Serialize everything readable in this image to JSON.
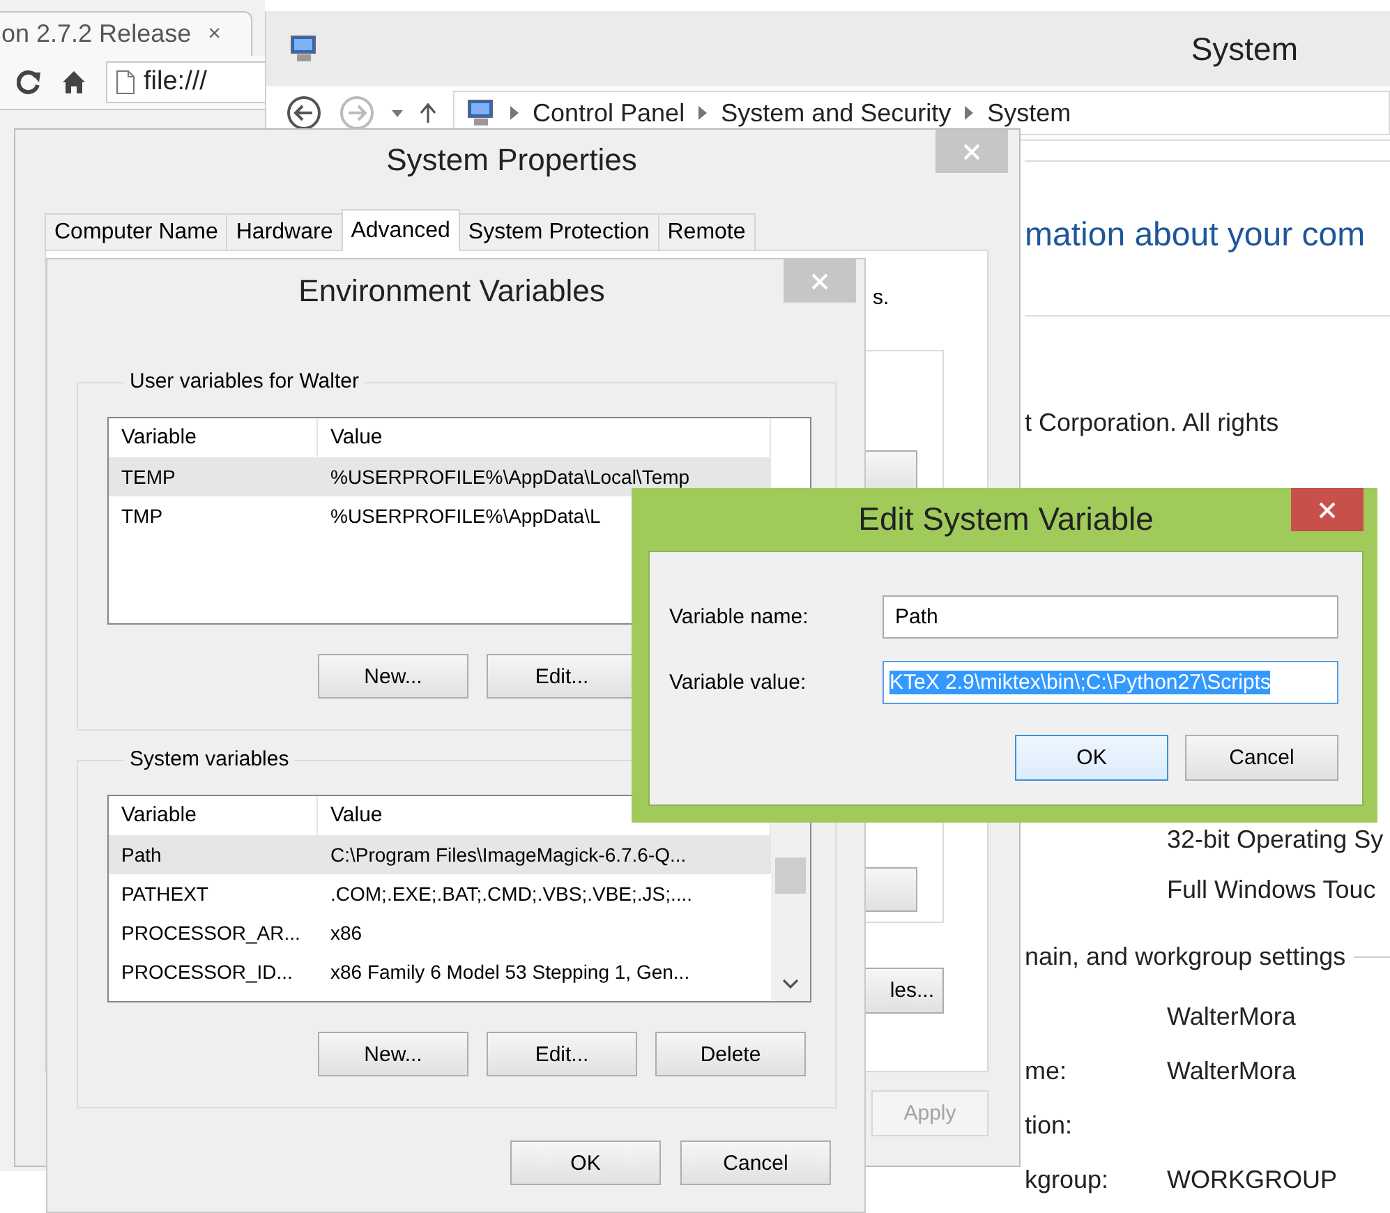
{
  "browser": {
    "tab": {
      "title": "on 2.7.2 Release",
      "close": "×"
    },
    "address": "file:///"
  },
  "control_panel": {
    "title": "System",
    "breadcrumb": [
      "Control Panel",
      "System and Security",
      "System"
    ],
    "heading": "mation about your com",
    "copyright": "t Corporation. All rights",
    "system_rows": [
      {
        "value": "32-bit Operating Sy"
      },
      {
        "value": "Full Windows Touc"
      }
    ],
    "section": "nain, and workgroup settings",
    "computer_rows": [
      {
        "value": "WalterMora"
      },
      {
        "label": "me:",
        "value": "WalterMora"
      },
      {
        "label": "tion:"
      },
      {
        "label": "kgroup:",
        "value": "WORKGROUP"
      }
    ]
  },
  "system_properties": {
    "title": "System Properties",
    "active": false,
    "tabs": [
      {
        "label": "Computer Name",
        "selected": false
      },
      {
        "label": "Hardware",
        "selected": false
      },
      {
        "label": "Advanced",
        "selected": true
      },
      {
        "label": "System Protection",
        "selected": false
      },
      {
        "label": "Remote",
        "selected": false
      }
    ],
    "description": "s.",
    "settings_button": "les...",
    "apply": {
      "label": "Apply",
      "disabled": true
    }
  },
  "environment_variables": {
    "title": "Environment Variables",
    "active": false,
    "user_group": {
      "title": "User variables for Walter",
      "columns": [
        "Variable",
        "Value"
      ],
      "rows": [
        {
          "variable": "TEMP",
          "value": "%USERPROFILE%\\AppData\\Local\\Temp",
          "selected": true
        },
        {
          "variable": "TMP",
          "value": "%USERPROFILE%\\AppData\\L",
          "selected": false
        }
      ],
      "buttons": [
        "New...",
        "Edit..."
      ]
    },
    "system_group": {
      "title": "System variables",
      "columns": [
        "Variable",
        "Value"
      ],
      "rows": [
        {
          "variable": "Path",
          "value": "C:\\Program Files\\ImageMagick-6.7.6-Q...",
          "selected": true
        },
        {
          "variable": "PATHEXT",
          "value": ".COM;.EXE;.BAT;.CMD;.VBS;.VBE;.JS;....",
          "selected": false
        },
        {
          "variable": "PROCESSOR_AR...",
          "value": "x86",
          "selected": false
        },
        {
          "variable": "PROCESSOR_ID...",
          "value": "x86 Family 6 Model 53 Stepping 1, Gen...",
          "selected": false
        }
      ],
      "buttons": [
        "New...",
        "Edit...",
        "Delete"
      ]
    },
    "buttons": [
      "OK",
      "Cancel"
    ]
  },
  "edit_variable": {
    "title": "Edit System Variable",
    "active": true,
    "fields": [
      {
        "label": "Variable name:",
        "value": "Path",
        "highlighted": false
      },
      {
        "label": "Variable value:",
        "value": "KTeX 2.9\\miktex\\bin\\;C:\\Python27\\Scripts",
        "highlighted": true
      }
    ],
    "buttons": [
      {
        "label": "OK",
        "focused": true
      },
      {
        "label": "Cancel",
        "focused": false
      }
    ]
  }
}
